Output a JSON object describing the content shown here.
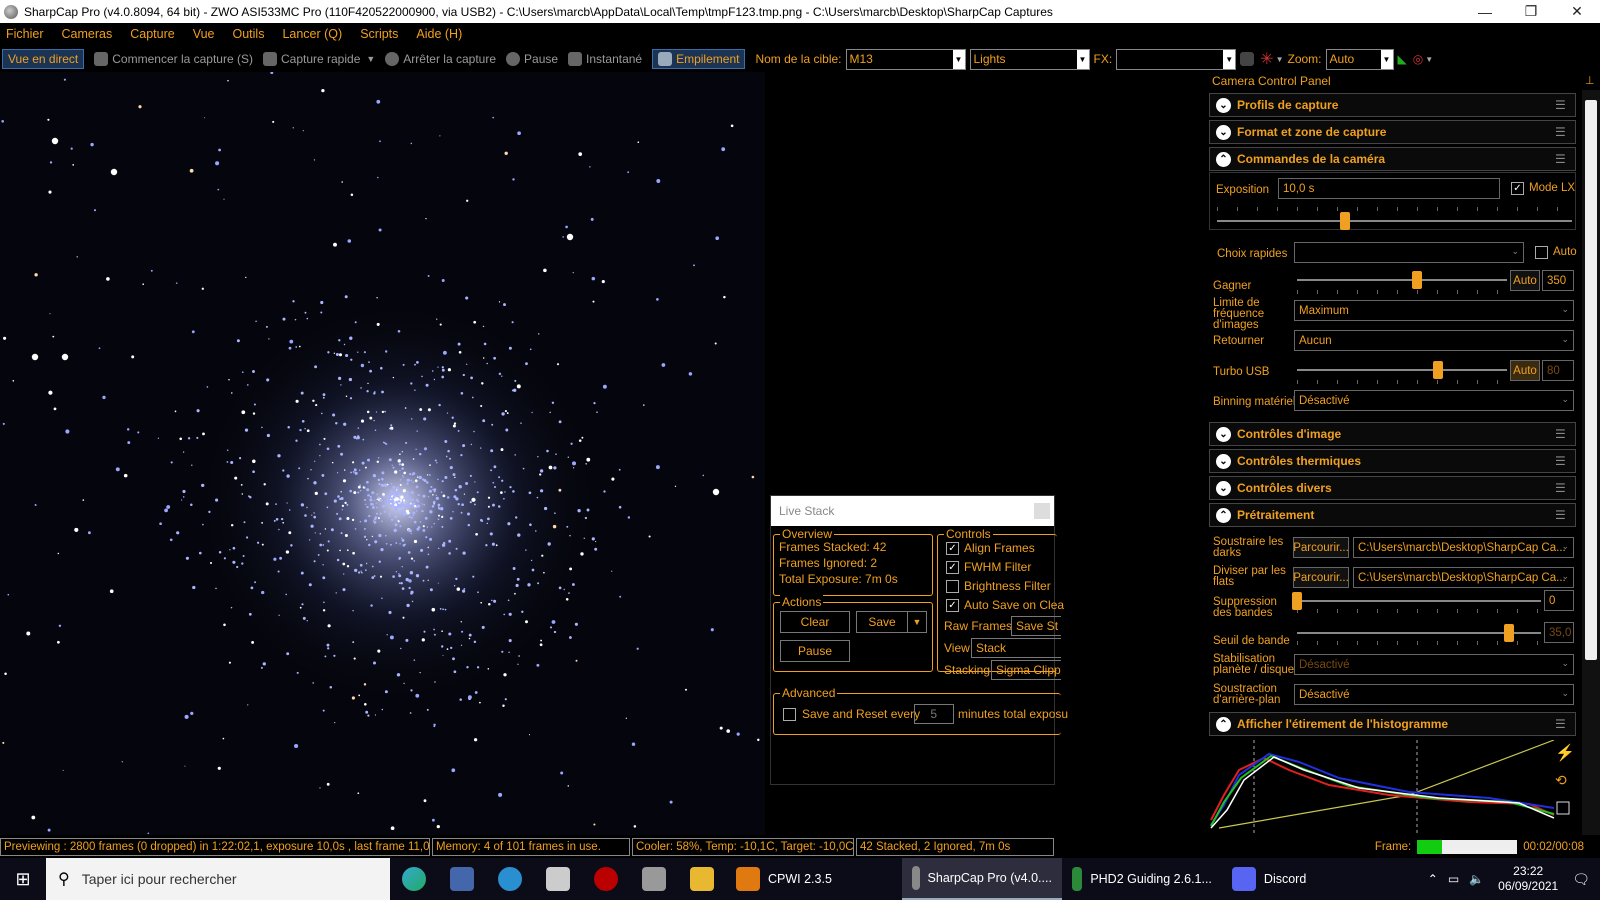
{
  "window": {
    "title": "SharpCap Pro (v4.0.8094, 64 bit) - ZWO ASI533MC Pro (110F420522000900, via USB2) - C:\\Users\\marcb\\AppData\\Local\\Temp\\tmpF123.tmp.png - C:\\Users\\marcb\\Desktop\\SharpCap Captures",
    "minimize": "—",
    "maximize": "❐",
    "close": "✕"
  },
  "menu": [
    "Fichier",
    "Cameras",
    "Capture",
    "Vue",
    "Outils",
    "Lancer (Q)",
    "Scripts",
    "Aide (H)"
  ],
  "toolbar": {
    "live": "Vue en direct",
    "start_capture": "Commencer la capture (S)",
    "quick_capture": "Capture rapide",
    "stop_capture": "Arrêter la capture",
    "pause": "Pause",
    "snapshot": "Instantané",
    "stacking": "Empilement",
    "target_label": "Nom de la cible:",
    "target_value": "M13",
    "frame_type": "Lights",
    "fx_label": "FX:",
    "fx_value": "",
    "zoom_label": "Zoom:",
    "zoom_value": "Auto"
  },
  "live_stack": {
    "title": "Live Stack",
    "overview_title": "Overview",
    "frames_stacked": "Frames Stacked: 42",
    "frames_ignored": "Frames Ignored:  2",
    "total_exposure": "Total Exposure:   7m 0s",
    "actions_title": "Actions",
    "clear": "Clear",
    "save": "Save",
    "pause": "Pause",
    "controls_title": "Controls",
    "align_frames": "Align Frames",
    "fwhm_filter": "FWHM Filter",
    "brightness_filter": "Brightness Filter",
    "auto_save": "Auto Save on Clea",
    "raw_frames_label": "Raw Frames",
    "raw_frames_value": "Save St",
    "view_label": "View",
    "view_value": "Stack",
    "stacking_label": "Stacking",
    "stacking_value": "Sigma Clipp",
    "advanced_title": "Advanced",
    "save_reset": "Save and Reset every",
    "save_reset_value": "5",
    "save_reset_suffix": "minutes total exposu"
  },
  "panel": {
    "title": "Camera Control Panel",
    "sections": {
      "profiles": "Profils de capture",
      "format": "Format et zone de capture",
      "camera": "Commandes de la caméra",
      "image": "Contrôles d'image",
      "thermal": "Contrôles thermiques",
      "misc": "Contrôles divers",
      "preprocessing": "Prétraitement",
      "histogram": "Afficher l'étirement de l'histogramme"
    },
    "exposure_label": "Exposition",
    "exposure_value": "10,0 s",
    "mode_lx": "Mode LX",
    "quick_choice_label": "Choix rapides",
    "auto": "Auto",
    "gain_label": "Gagner",
    "gain_auto": "Auto",
    "gain_value": "350",
    "gain_level": 0.57,
    "exposure_slider": 0.36,
    "fps_limit_label": "Limite de fréquence d'images",
    "fps_limit_value": "Maximum",
    "flip_label": "Retourner",
    "flip_value": "Aucun",
    "turbo_label": "Turbo USB",
    "turbo_auto": "Auto",
    "turbo_value": "80",
    "turbo_level": 0.67,
    "binning_label": "Binning matériel",
    "binning_value": "Désactivé",
    "darks_label": "Soustraire les darks",
    "browse": "Parcourir...",
    "darks_path": "C:\\Users\\marcb\\Desktop\\SharpCap Ca...",
    "flats_label": "Diviser par les flats",
    "flats_path": "C:\\Users\\marcb\\Desktop\\SharpCap Ca...",
    "banding_label": "Suppression des bandes",
    "banding_value": "0",
    "banding_level": 0.0,
    "band_threshold_label": "Seuil de bande",
    "band_threshold_value": "35,0",
    "band_threshold_level": 0.87,
    "stabilization_label": "Stabilisation planète / disque",
    "stabilization_value": "Désactivé",
    "background_label": "Soustraction d'arrière-plan",
    "background_value": "Désactivé"
  },
  "status": {
    "preview": "Previewing : 2800 frames (0 dropped) in 1:22:02,1, exposure 10,0s , last frame 11,0s",
    "memory": "Memory: 4 of 101 frames in use.",
    "cooler": "Cooler: 58%, Temp: -10,1C, Target: -10,0C",
    "stack": "42 Stacked, 2 Ignored, 7m 0s",
    "frame_label": "Frame:",
    "frame_time": "00:02/00:08",
    "frame_progress": 0.25
  },
  "taskbar": {
    "search_placeholder": "Taper ici pour rechercher",
    "apps": [
      {
        "name": "CPWI 2.3.5",
        "color": "#e07a10"
      },
      {
        "name": "SharpCap Pro (v4.0....",
        "color": "#888888"
      },
      {
        "name": "PHD2 Guiding 2.6.1...",
        "color": "#2a8a3a"
      },
      {
        "name": "Discord",
        "color": "#5865f2"
      }
    ],
    "time": "23:22",
    "date": "06/09/2021"
  }
}
